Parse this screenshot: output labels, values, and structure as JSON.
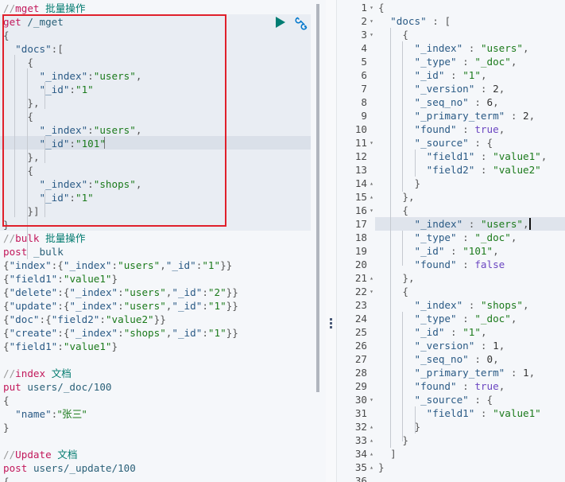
{
  "request_editor": {
    "lines": [
      {
        "kind": "comment",
        "cmd": "mget",
        "text": "批量操作"
      },
      {
        "kind": "method",
        "method": "get",
        "url": "/_mget"
      },
      {
        "kind": "raw",
        "text": "{"
      },
      {
        "kind": "raw",
        "text": "  \"docs\":["
      },
      {
        "kind": "raw",
        "text": "    {"
      },
      {
        "kind": "raw",
        "text": "      \"_index\":\"users\","
      },
      {
        "kind": "raw",
        "text": "      \"_id\":\"1\""
      },
      {
        "kind": "raw",
        "text": "    },"
      },
      {
        "kind": "raw",
        "text": "    {"
      },
      {
        "kind": "raw",
        "text": "      \"_index\":\"users\","
      },
      {
        "kind": "raw",
        "text": "      \"_id\":\"101\""
      },
      {
        "kind": "raw",
        "text": "    },"
      },
      {
        "kind": "raw",
        "text": "    {"
      },
      {
        "kind": "raw",
        "text": "      \"_index\":\"shops\","
      },
      {
        "kind": "raw",
        "text": "      \"_id\":\"1\""
      },
      {
        "kind": "raw",
        "text": "    }]"
      },
      {
        "kind": "raw",
        "text": "}"
      },
      {
        "kind": "comment",
        "cmd": "bulk",
        "text": "批量操作"
      },
      {
        "kind": "method",
        "method": "post",
        "url": "_bulk"
      },
      {
        "kind": "raw",
        "text": "{\"index\":{\"_index\":\"users\",\"_id\":\"1\"}}"
      },
      {
        "kind": "raw",
        "text": "{\"field1\":\"value1\"}"
      },
      {
        "kind": "raw",
        "text": "{\"delete\":{\"_index\":\"users\",\"_id\":\"2\"}}"
      },
      {
        "kind": "raw",
        "text": "{\"update\":{\"_index\":\"users\",\"_id\":\"1\"}}"
      },
      {
        "kind": "raw",
        "text": "{\"doc\":{\"field2\":\"value2\"}}"
      },
      {
        "kind": "raw",
        "text": "{\"create\":{\"_index\":\"shops\",\"_id\":\"1\"}}"
      },
      {
        "kind": "raw",
        "text": "{\"field1\":\"value1\"}"
      },
      {
        "kind": "raw",
        "text": ""
      },
      {
        "kind": "comment",
        "cmd": "index",
        "text": "文档"
      },
      {
        "kind": "method",
        "method": "put",
        "url": "users/_doc/100"
      },
      {
        "kind": "raw",
        "text": "{"
      },
      {
        "kind": "raw",
        "text": "  \"name\":\"张三\""
      },
      {
        "kind": "raw",
        "text": "}"
      },
      {
        "kind": "raw",
        "text": ""
      },
      {
        "kind": "comment",
        "cmd": "Update",
        "text": "文档"
      },
      {
        "kind": "method",
        "method": "post",
        "url": "users/_update/100"
      },
      {
        "kind": "raw",
        "text": "{"
      }
    ],
    "run_button_label": "Send request",
    "settings_button_label": "Request settings"
  },
  "response_viewer": {
    "lines": [
      {
        "n": "1",
        "fold": "open",
        "text": "{"
      },
      {
        "n": "2",
        "fold": "open",
        "text": "  \"docs\" : ["
      },
      {
        "n": "3",
        "fold": "open",
        "text": "    {"
      },
      {
        "n": "4",
        "fold": "",
        "text": "      \"_index\" : \"users\","
      },
      {
        "n": "5",
        "fold": "",
        "text": "      \"_type\" : \"_doc\","
      },
      {
        "n": "6",
        "fold": "",
        "text": "      \"_id\" : \"1\","
      },
      {
        "n": "7",
        "fold": "",
        "text": "      \"_version\" : 2,"
      },
      {
        "n": "8",
        "fold": "",
        "text": "      \"_seq_no\" : 6,"
      },
      {
        "n": "9",
        "fold": "",
        "text": "      \"_primary_term\" : 2,"
      },
      {
        "n": "10",
        "fold": "",
        "text": "      \"found\" : true,"
      },
      {
        "n": "11",
        "fold": "open",
        "text": "      \"_source\" : {"
      },
      {
        "n": "12",
        "fold": "",
        "text": "        \"field1\" : \"value1\","
      },
      {
        "n": "13",
        "fold": "",
        "text": "        \"field2\" : \"value2\""
      },
      {
        "n": "14",
        "fold": "close",
        "text": "      }"
      },
      {
        "n": "15",
        "fold": "close",
        "text": "    },"
      },
      {
        "n": "16",
        "fold": "open",
        "text": "    {"
      },
      {
        "n": "17",
        "fold": "",
        "text": "      \"_index\" : \"users\","
      },
      {
        "n": "18",
        "fold": "",
        "text": "      \"_type\" : \"_doc\","
      },
      {
        "n": "19",
        "fold": "",
        "text": "      \"_id\" : \"101\","
      },
      {
        "n": "20",
        "fold": "",
        "text": "      \"found\" : false"
      },
      {
        "n": "21",
        "fold": "close",
        "text": "    },"
      },
      {
        "n": "22",
        "fold": "open",
        "text": "    {"
      },
      {
        "n": "23",
        "fold": "",
        "text": "      \"_index\" : \"shops\","
      },
      {
        "n": "24",
        "fold": "",
        "text": "      \"_type\" : \"_doc\","
      },
      {
        "n": "25",
        "fold": "",
        "text": "      \"_id\" : \"1\","
      },
      {
        "n": "26",
        "fold": "",
        "text": "      \"_version\" : 1,"
      },
      {
        "n": "27",
        "fold": "",
        "text": "      \"_seq_no\" : 0,"
      },
      {
        "n": "28",
        "fold": "",
        "text": "      \"_primary_term\" : 1,"
      },
      {
        "n": "29",
        "fold": "",
        "text": "      \"found\" : true,"
      },
      {
        "n": "30",
        "fold": "open",
        "text": "      \"_source\" : {"
      },
      {
        "n": "31",
        "fold": "",
        "text": "        \"field1\" : \"value1\""
      },
      {
        "n": "32",
        "fold": "close",
        "text": "      }"
      },
      {
        "n": "33",
        "fold": "close",
        "text": "    }"
      },
      {
        "n": "34",
        "fold": "close",
        "text": "  ]"
      },
      {
        "n": "35",
        "fold": "close",
        "text": "}"
      },
      {
        "n": "36",
        "fold": "",
        "text": ""
      }
    ]
  },
  "icons": {
    "run": "play-icon",
    "settings": "wrench-icon",
    "fold_open": "▾",
    "fold_close": "▴"
  },
  "colors": {
    "highlight_box": "#e0202b",
    "run_button": "#017d73",
    "settings_icon": "#0077cc"
  }
}
